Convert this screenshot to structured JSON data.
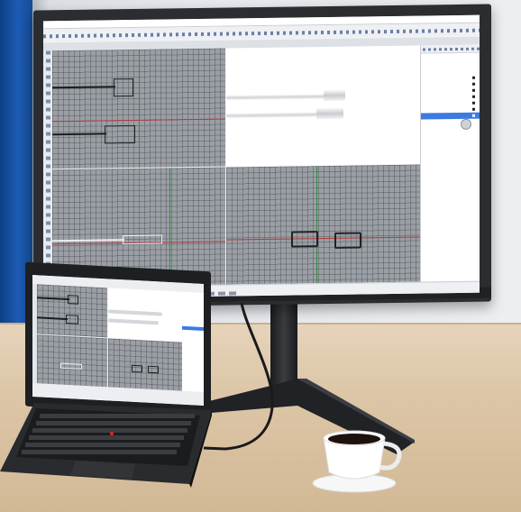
{
  "scene": {
    "description_tags": [
      "external-monitor",
      "laptop",
      "coffee-cup",
      "desk"
    ],
    "colors": {
      "curtain": "#1d5bb4",
      "desk": "#dcc5a6",
      "bezel": "#2b2d31",
      "viewport_gray": "#9a9fa6",
      "selection_blue": "#3d7be0"
    }
  },
  "cad_app": {
    "viewports": [
      {
        "id": "top",
        "active": false
      },
      {
        "id": "perspective",
        "active": true
      },
      {
        "id": "front",
        "active": false
      },
      {
        "id": "right",
        "active": false
      }
    ],
    "layers_panel": {
      "rows": [
        {
          "selected": false
        },
        {
          "selected": false
        },
        {
          "selected": false
        },
        {
          "selected": false
        },
        {
          "selected": false
        },
        {
          "selected": false
        },
        {
          "selected": true
        }
      ]
    }
  },
  "icons": {
    "monitor_logo": "brand-logo",
    "cursor": "mouse-pointer-icon"
  }
}
